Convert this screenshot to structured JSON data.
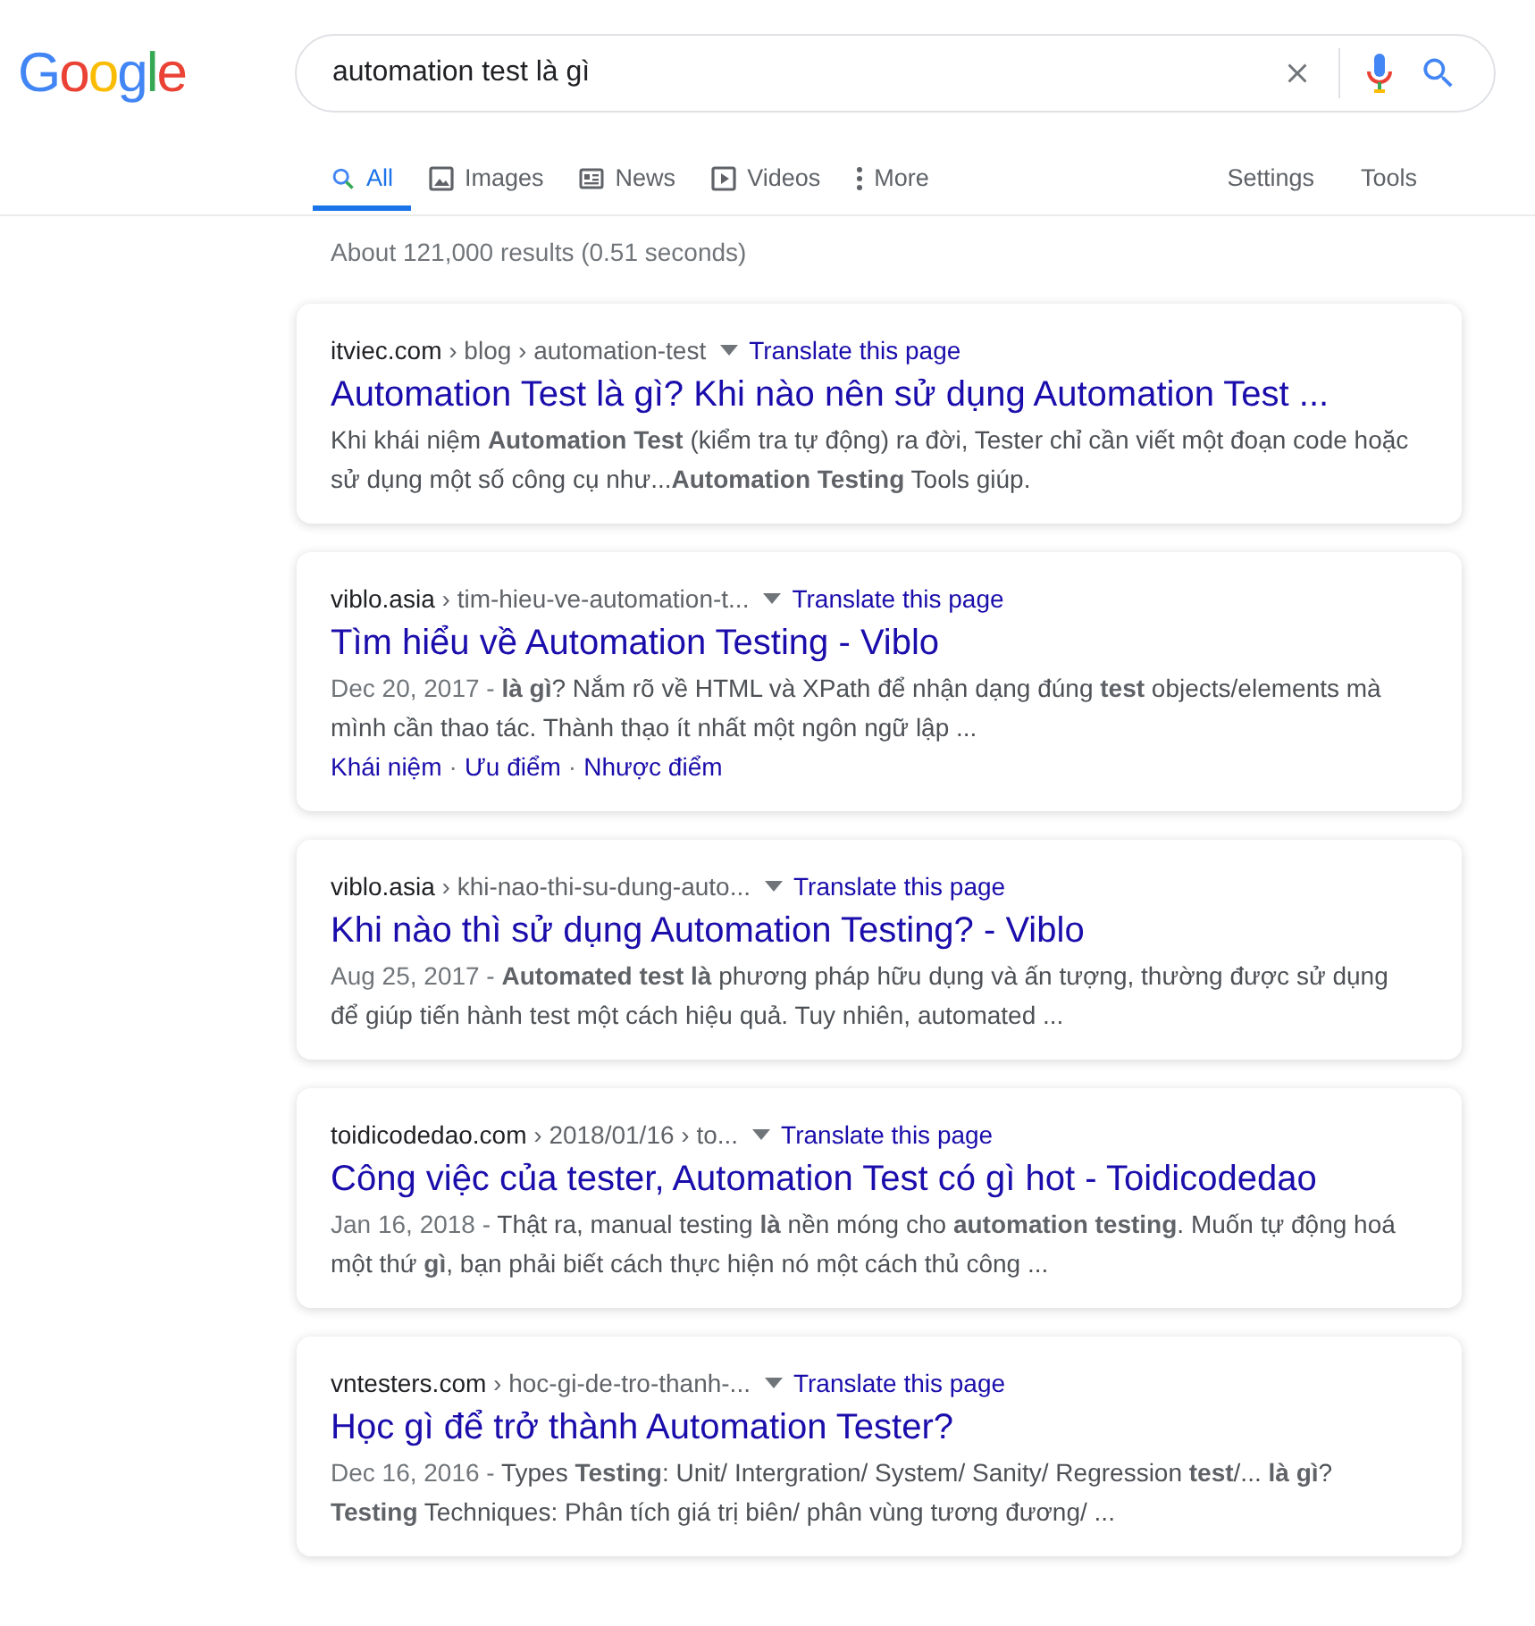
{
  "logo": "Google",
  "search": {
    "value": "automation test là gì"
  },
  "tabs": [
    {
      "label": "All",
      "kind": "all",
      "selected": true
    },
    {
      "label": "Images",
      "kind": "images",
      "selected": false
    },
    {
      "label": "News",
      "kind": "news",
      "selected": false
    },
    {
      "label": "Videos",
      "kind": "videos",
      "selected": false
    },
    {
      "label": "More",
      "kind": "more",
      "selected": false
    }
  ],
  "tools": [
    "Settings",
    "Tools"
  ],
  "result_stats": "About 121,000 results (0.51 seconds)",
  "results": [
    {
      "domain": "itviec.com",
      "path": " › blog › automation-test",
      "translate": "Translate this page",
      "title": "Automation Test là gì? Khi nào nên sử dụng Automation Test ...",
      "snippet": "Khi khái niệm **Automation Test** (kiểm tra tự động) ra đời, Tester chỉ cần viết một đoạn code hoặc sử dụng một số công cụ như...**Automation Testing** Tools giúp."
    },
    {
      "domain": "viblo.asia",
      "path": " › tim-hieu-ve-automation-t...",
      "translate": "Translate this page",
      "title": "Tìm hiểu về Automation Testing - Viblo",
      "date": "Dec 20, 2017 - ",
      "snippet": "**là gì**? Nắm rõ về HTML và XPath để nhận dạng đúng **test** objects/elements mà mình cần thao tác. Thành thạo ít nhất một ngôn ngữ lập ...",
      "sitelinks": [
        "Khái niệm",
        "Ưu điểm",
        "Nhược điểm"
      ],
      "sitelink_separator": "·"
    },
    {
      "domain": "viblo.asia",
      "path": " › khi-nao-thi-su-dung-auto...",
      "translate": "Translate this page",
      "title": "Khi nào thì sử dụng Automation Testing? - Viblo",
      "date": "Aug 25, 2017 - ",
      "snippet": "**Automated test là** phương pháp hữu dụng và ấn tượng, thường được sử dụng để giúp tiến hành test một cách hiệu quả. Tuy nhiên, automated ..."
    },
    {
      "domain": "toidicodedao.com",
      "path": " › 2018/01/16 › to...",
      "translate": "Translate this page",
      "title": "Công việc của tester, Automation Test có gì hot - Toidicodedao",
      "date": "Jan 16, 2018 - ",
      "snippet": "Thật ra, manual testing **là** nền móng cho **automation testing**. Muốn tự động hoá một thứ **gì**, bạn phải biết cách thực hiện nó một cách thủ công ..."
    },
    {
      "domain": "vntesters.com",
      "path": " › hoc-gi-de-tro-thanh-...",
      "translate": "Translate this page",
      "title": "Học gì để trở thành Automation Tester?",
      "date": "Dec 16, 2016 - ",
      "snippet": "Types **Testing**: Unit/ Intergration/ System/ Sanity/ Regression **test**/... **là gì**? **Testing** Techniques: Phân tích giá trị biên/ phân vùng tương đương/ ..."
    }
  ]
}
